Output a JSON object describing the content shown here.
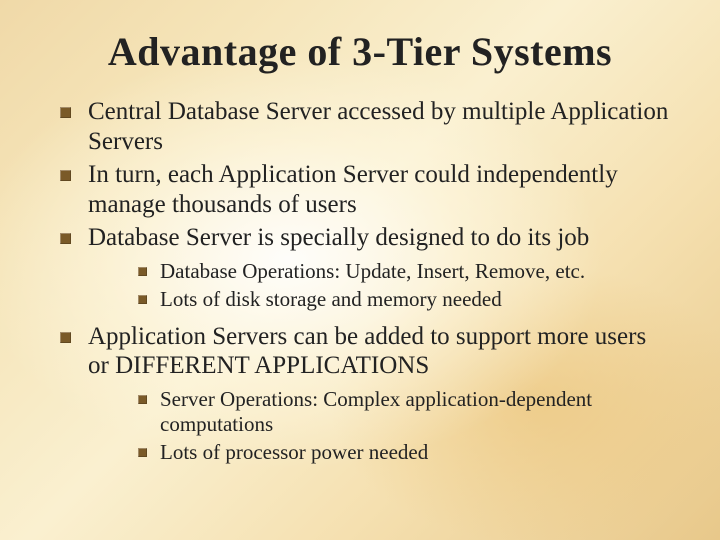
{
  "title": "Advantage of 3-Tier Systems",
  "bullets": {
    "b1": "Central Database Server accessed by multiple Application Servers",
    "b2": "In turn, each Application Server could independently manage thousands of users",
    "b3": "Database Server is specially designed to do its job",
    "b3_sub": {
      "s1": "Database Operations: Update, Insert, Remove, etc.",
      "s2": "Lots of disk storage and memory needed"
    },
    "b4": "Application Servers can be added to support more users or DIFFERENT APPLICATIONS",
    "b4_sub": {
      "s1": "Server Operations: Complex application-dependent computations",
      "s2": "Lots of processor power needed"
    }
  }
}
